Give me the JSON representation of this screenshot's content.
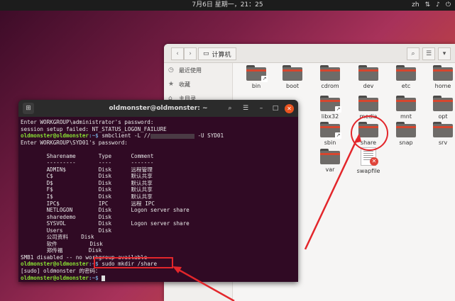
{
  "topbar": {
    "clock": "7月6日 星期一，21：25",
    "lang": "zh",
    "icons": [
      "network-icon",
      "volume-icon",
      "power-icon"
    ]
  },
  "file_manager": {
    "nav_back": "‹",
    "nav_forward": "›",
    "path_label": "计算机",
    "sidebar": [
      {
        "label": "最近使用",
        "icon": "clock-icon"
      },
      {
        "label": "收藏",
        "icon": "star-icon"
      },
      {
        "label": "主目录",
        "icon": "home-icon"
      }
    ],
    "items": [
      {
        "name": "bin",
        "link": true
      },
      {
        "name": "boot"
      },
      {
        "name": "cdrom"
      },
      {
        "name": "dev"
      },
      {
        "name": "etc"
      },
      {
        "name": "home"
      },
      {
        "name": "libx32",
        "link": true
      },
      {
        "name": "media"
      },
      {
        "name": "mnt"
      },
      {
        "name": "opt"
      },
      {
        "name": "sbin",
        "link": true
      },
      {
        "name": "share"
      },
      {
        "name": "snap"
      },
      {
        "name": "srv"
      },
      {
        "name": "var"
      },
      {
        "name": "swapfile",
        "file": true
      }
    ]
  },
  "terminal": {
    "title": "oldmonster@oldmonster: ~",
    "prompt_user": "oldmonster@oldmonster",
    "prompt_path": ":~$",
    "lines": [
      "Enter WORKGROUP\\administrator's password:",
      "session setup failed: NT_STATUS_LOGON_FAILURE",
      "smbclient -L //",
      "-U SYD01",
      "Enter WORKGROUP\\SYD01's password:",
      "",
      "        Sharename       Type      Comment",
      "        ---------       ----      -------",
      "        ADMIN$          Disk      远程管理",
      "        C$              Disk      默认共享",
      "        D$              Disk      默认共享",
      "        F$              Disk      默认共享",
      "        I$              Disk      默认共享",
      "        IPC$            IPC       远程 IPC",
      "        NETLOGON        Disk      Logon server share",
      "        sharedemo       Disk",
      "        SYSVOL          Disk      Logon server share",
      "        Users           Disk",
      "        公司资料    Disk",
      "        软件          Disk",
      "        郑传福        Disk",
      "SMB1 disabled -- no workgroup available",
      "sudo mkdir /share",
      "[sudo] oldmonster 的密码："
    ]
  }
}
